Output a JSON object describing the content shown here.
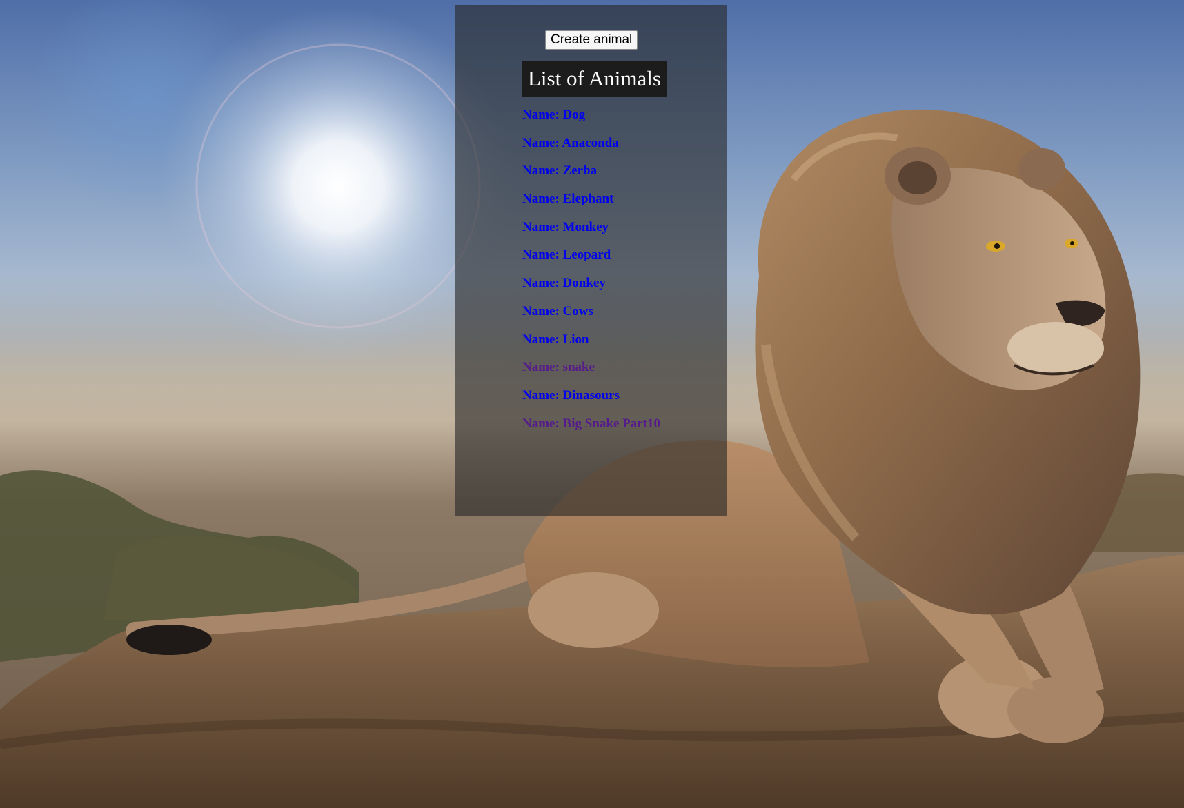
{
  "toolbar": {
    "create_label": "Create animal"
  },
  "list": {
    "title": "List of Animals",
    "items": [
      {
        "label": "Name: Dog",
        "visited": false
      },
      {
        "label": "Name: Anaconda",
        "visited": false
      },
      {
        "label": "Name: Zerba",
        "visited": false
      },
      {
        "label": "Name: Elephant",
        "visited": false
      },
      {
        "label": "Name: Monkey",
        "visited": false
      },
      {
        "label": "Name: Leopard",
        "visited": false
      },
      {
        "label": "Name: Donkey",
        "visited": false
      },
      {
        "label": "Name: Cows",
        "visited": false
      },
      {
        "label": "Name: Lion",
        "visited": false
      },
      {
        "label": "Name: snake",
        "visited": true
      },
      {
        "label": "Name: Dinasours",
        "visited": false
      },
      {
        "label": "Name: Big Snake Part10",
        "visited": true
      }
    ]
  },
  "colors": {
    "link": "#0000ee",
    "link_visited": "#551a8b",
    "panel_overlay": "rgba(40,40,40,0.62)",
    "title_background": "#1c1c1c"
  },
  "background": {
    "subject": "lion-on-rock-photo"
  }
}
